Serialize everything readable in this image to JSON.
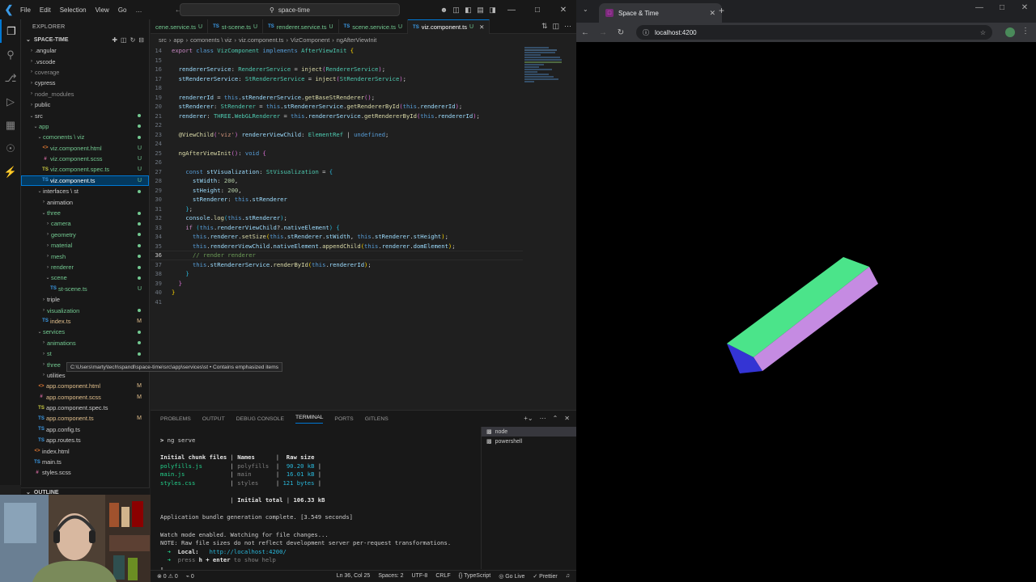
{
  "vscode": {
    "menu": [
      "File",
      "Edit",
      "Selection",
      "View",
      "Go",
      "…"
    ],
    "search": "space-time",
    "explorer_title": "EXPLORER",
    "workspace": "SPACE-TIME",
    "outline_title": "OUTLINE",
    "tree": [
      {
        "label": ".angular",
        "depth": 1,
        "type": "folder",
        "open": false
      },
      {
        "label": ".vscode",
        "depth": 1,
        "type": "folder",
        "open": false
      },
      {
        "label": "coverage",
        "depth": 1,
        "type": "folder",
        "open": false,
        "dim": true
      },
      {
        "label": "cypress",
        "depth": 1,
        "type": "folder",
        "open": false
      },
      {
        "label": "node_modules",
        "depth": 1,
        "type": "folder",
        "open": false,
        "dim": true
      },
      {
        "label": "public",
        "depth": 1,
        "type": "folder",
        "open": false
      },
      {
        "label": "src",
        "depth": 1,
        "type": "folder",
        "open": true,
        "dot": "u"
      },
      {
        "label": "app",
        "depth": 2,
        "type": "folder",
        "open": true,
        "dot": "u",
        "color": "u"
      },
      {
        "label": "comonents \\ viz",
        "depth": 3,
        "type": "folder",
        "open": true,
        "dot": "u",
        "color": "u"
      },
      {
        "label": "viz.component.html",
        "depth": 4,
        "type": "html",
        "badge": "U",
        "color": "u"
      },
      {
        "label": "viz.component.scss",
        "depth": 4,
        "type": "css",
        "badge": "U",
        "color": "u"
      },
      {
        "label": "viz.component.spec.ts",
        "depth": 4,
        "type": "spec",
        "badge": "U",
        "color": "u"
      },
      {
        "label": "viz.component.ts",
        "depth": 4,
        "type": "ts",
        "badge": "U",
        "color": "u",
        "selected": true
      },
      {
        "label": "interfaces \\ st",
        "depth": 3,
        "type": "folder",
        "open": true,
        "dot": "u"
      },
      {
        "label": "animation",
        "depth": 4,
        "type": "folder",
        "open": false
      },
      {
        "label": "three",
        "depth": 4,
        "type": "folder",
        "open": true,
        "dot": "u",
        "color": "u"
      },
      {
        "label": "camera",
        "depth": 5,
        "type": "folder",
        "open": false,
        "dot": "u",
        "color": "u"
      },
      {
        "label": "geometry",
        "depth": 5,
        "type": "folder",
        "open": false,
        "dot": "u",
        "color": "u"
      },
      {
        "label": "material",
        "depth": 5,
        "type": "folder",
        "open": false,
        "dot": "u",
        "color": "u"
      },
      {
        "label": "mesh",
        "depth": 5,
        "type": "folder",
        "open": false,
        "dot": "u",
        "color": "u"
      },
      {
        "label": "renderer",
        "depth": 5,
        "type": "folder",
        "open": false,
        "dot": "u",
        "color": "u"
      },
      {
        "label": "scene",
        "depth": 5,
        "type": "folder",
        "open": true,
        "dot": "u",
        "color": "u"
      },
      {
        "label": "st-scene.ts",
        "depth": 6,
        "type": "ts",
        "badge": "U",
        "color": "u"
      },
      {
        "label": "triple",
        "depth": 4,
        "type": "folder",
        "open": false
      },
      {
        "label": "visualization",
        "depth": 4,
        "type": "folder",
        "open": false,
        "dot": "u",
        "color": "u"
      },
      {
        "label": "index.ts",
        "depth": 4,
        "type": "ts",
        "badge": "M",
        "color": "m"
      },
      {
        "label": "services",
        "depth": 3,
        "type": "folder",
        "open": true,
        "dot": "u",
        "color": "u"
      },
      {
        "label": "animations",
        "depth": 4,
        "type": "folder",
        "open": false,
        "dot": "u",
        "color": "u"
      },
      {
        "label": "st",
        "depth": 4,
        "type": "folder",
        "open": false,
        "dot": "u",
        "color": "u"
      },
      {
        "label": "three",
        "depth": 4,
        "type": "folder",
        "open": false,
        "dot": "u",
        "color": "u"
      },
      {
        "label": "utilities",
        "depth": 4,
        "type": "folder",
        "open": false
      },
      {
        "label": "app.component.html",
        "depth": 3,
        "type": "html",
        "badge": "M",
        "color": "m"
      },
      {
        "label": "app.component.scss",
        "depth": 3,
        "type": "css",
        "badge": "M",
        "color": "m"
      },
      {
        "label": "app.component.spec.ts",
        "depth": 3,
        "type": "spec"
      },
      {
        "label": "app.component.ts",
        "depth": 3,
        "type": "ts",
        "badge": "M",
        "color": "m"
      },
      {
        "label": "app.config.ts",
        "depth": 3,
        "type": "ts"
      },
      {
        "label": "app.routes.ts",
        "depth": 3,
        "type": "ts"
      },
      {
        "label": "index.html",
        "depth": 2,
        "type": "html"
      },
      {
        "label": "main.ts",
        "depth": 2,
        "type": "ts"
      },
      {
        "label": "styles.scss",
        "depth": 2,
        "type": "css"
      }
    ],
    "tooltip": "C:\\Users\\marty\\tech\\spandl\\space-time\\src\\app\\services\\st • Contains emphasized items",
    "tabs": [
      {
        "label": "cene.service.ts",
        "badge": "U"
      },
      {
        "label": "st-scene.ts",
        "badge": "U"
      },
      {
        "label": "renderer.service.ts",
        "badge": "U"
      },
      {
        "label": "scene.service.ts",
        "badge": "U"
      },
      {
        "label": "viz.component.ts",
        "badge": "U",
        "active": true
      }
    ],
    "breadcrumbs": [
      "src",
      "app",
      "comonents \\ viz",
      "viz.component.ts",
      "VizComponent",
      "ngAfterViewInit"
    ],
    "panel_tabs": [
      "PROBLEMS",
      "OUTPUT",
      "DEBUG CONSOLE",
      "TERMINAL",
      "PORTS",
      "GITLENS"
    ],
    "panel_active": "TERMINAL",
    "terminals": [
      "node",
      "powershell"
    ],
    "status_left": [
      "⊗ 0 ⚠ 0",
      "⌁ 0"
    ],
    "status_right": [
      "Ln 36, Col 25",
      "Spaces: 2",
      "UTF-8",
      "CRLF",
      "{} TypeScript",
      "◎ Go Live",
      "✓ Prettier"
    ]
  },
  "browser": {
    "tab_title": "Space & Time",
    "url": "localhost:4200"
  }
}
